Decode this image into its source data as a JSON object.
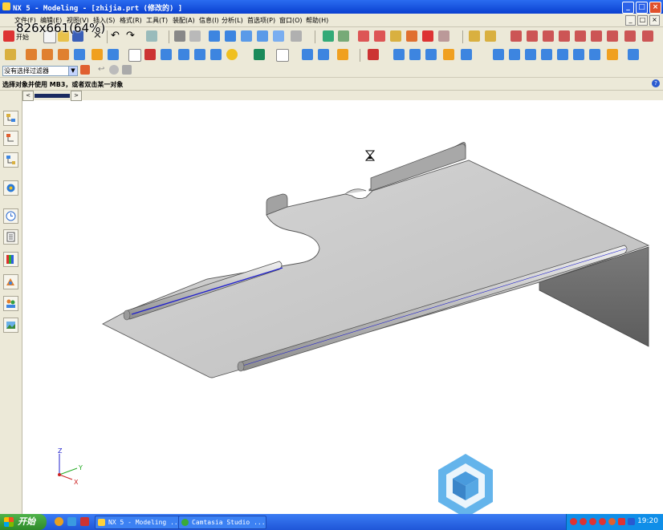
{
  "window": {
    "title": "NX 5 - Modeling - [zhijia.prt (修改的) ]",
    "zoom_overlay": "826x661(64%)",
    "controls": [
      "_",
      "□",
      "×"
    ]
  },
  "menu": {
    "items": [
      "文件(F)",
      "编辑(E)",
      "视图(V)",
      "插入(S)",
      "格式(R)",
      "工具(T)",
      "装配(A)",
      "信息(I)",
      "分析(L)",
      "首选项(P)",
      "窗口(O)",
      "帮助(H)"
    ],
    "mdi_controls": [
      "_",
      "□",
      "×"
    ]
  },
  "toolbar": {
    "start_label": "开始",
    "filter_value": "没有选择过滤器"
  },
  "status": {
    "prompt": "选择对象并使用 MB3，或者双击某一对象"
  },
  "scrollbar": {
    "left_arrow": "<",
    "right_arrow": ">"
  },
  "viewport": {
    "triad": {
      "x_label": "X",
      "y_label": "Y",
      "z_label": "Z"
    }
  },
  "taskbar": {
    "start_label": "开始",
    "tasks": [
      "NX 5 - Modeling ...",
      "Camtasia Studio ..."
    ],
    "clock": "19:20"
  },
  "colors": {
    "title_blue": "#0a3fd0",
    "menu_bg": "#ece9d8",
    "model_gray": "#c8c8c8",
    "edge_blue": "#2222cc",
    "taskbar_blue": "#1f56d8"
  }
}
